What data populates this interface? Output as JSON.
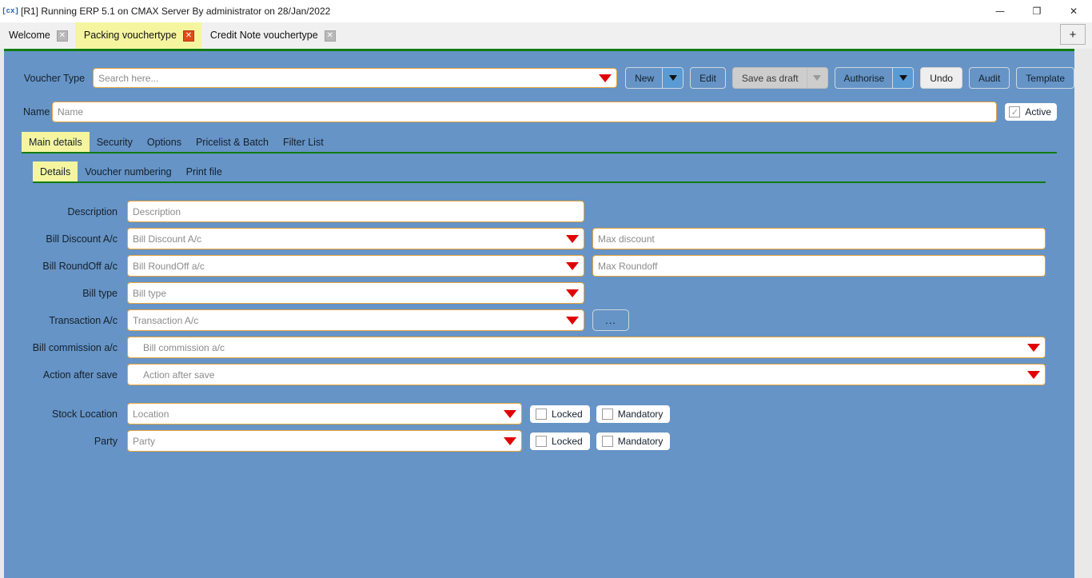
{
  "window": {
    "title": "[R1] Running ERP 5.1 on CMAX Server By administrator on 28/Jan/2022",
    "app_icon": "[cx]",
    "minimize": "—",
    "maximize": "❐",
    "close": "✕"
  },
  "tabs": {
    "items": [
      {
        "label": "Welcome",
        "active": false,
        "close": "✕"
      },
      {
        "label": "Packing vouchertype",
        "active": true,
        "close": "✕"
      },
      {
        "label": "Credit Note vouchertype",
        "active": false,
        "close": "✕"
      }
    ],
    "new_tab": "+"
  },
  "toolbar": {
    "voucher_type_label": "Voucher Type",
    "search_placeholder": "Search here...",
    "new_label": "New",
    "edit_label": "Edit",
    "save_as_draft_label": "Save as draft",
    "authorise_label": "Authorise",
    "undo_label": "Undo",
    "audit_label": "Audit",
    "template_label": "Template"
  },
  "name_row": {
    "label": "Name",
    "placeholder": "Name",
    "active_label": "Active",
    "active_checked_mark": "✓"
  },
  "main_tabs": [
    {
      "label": "Main details",
      "active": true
    },
    {
      "label": "Security",
      "active": false
    },
    {
      "label": "Options",
      "active": false
    },
    {
      "label": "Pricelist & Batch",
      "active": false
    },
    {
      "label": "Filter List",
      "active": false
    }
  ],
  "sub_tabs": [
    {
      "label": "Details",
      "active": true
    },
    {
      "label": "Voucher numbering",
      "active": false
    },
    {
      "label": "Print file",
      "active": false
    }
  ],
  "form": {
    "description": {
      "label": "Description",
      "placeholder": "Description"
    },
    "bill_discount": {
      "label": "Bill Discount A/c",
      "placeholder": "Bill Discount A/c"
    },
    "max_discount": {
      "placeholder": "Max discount"
    },
    "bill_roundoff": {
      "label": "Bill RoundOff a/c",
      "placeholder": "Bill RoundOff a/c"
    },
    "max_roundoff": {
      "placeholder": "Max Roundoff"
    },
    "bill_type": {
      "label": "Bill type",
      "placeholder": "Bill type"
    },
    "transaction_ac": {
      "label": "Transaction A/c",
      "placeholder": "Transaction A/c",
      "browse": "..."
    },
    "bill_commission": {
      "label": "Bill commission a/c",
      "placeholder": "Bill commission a/c"
    },
    "action_after_save": {
      "label": "Action after save",
      "placeholder": "Action after save"
    },
    "stock_location": {
      "label": "Stock Location",
      "placeholder": "Location",
      "locked": "Locked",
      "mandatory": "Mandatory"
    },
    "party": {
      "label": "Party",
      "placeholder": "Party",
      "locked": "Locked",
      "mandatory": "Mandatory"
    }
  },
  "colors": {
    "canvas": "#6694c6",
    "accent_border": "#e8a33d",
    "tab_active": "#f5f5a0",
    "tab_underline": "#127b12",
    "caret_red": "#e00000",
    "close_active": "#e04a18"
  }
}
